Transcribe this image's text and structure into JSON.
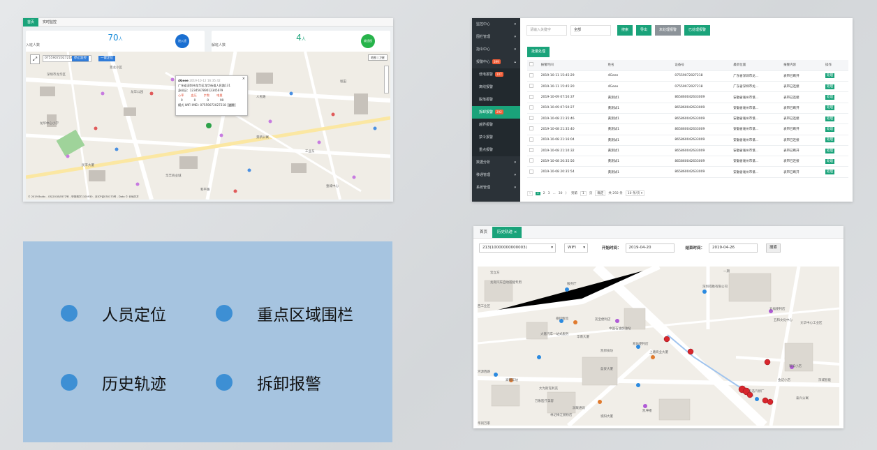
{
  "dashboard": {
    "tabs": [
      "首页",
      "实时监控"
    ],
    "stat_in": {
      "num": "70",
      "unit": "人",
      "label": "入班人数",
      "circle": "进入班"
    },
    "stat_out": {
      "num": "4",
      "unit": "人",
      "label": "解班人数",
      "circle": "收班权"
    },
    "device_input": "07559072027218",
    "map_btn1": "停止监控",
    "map_btn2": "一键定位",
    "popup": {
      "name": "4Geee",
      "time": "2019-10-12 16:35:42",
      "addr": "广东省深圳市龙华区龙华街道人民路131",
      "imei": "身份证：1234567890123456?9",
      "row1": [
        "心率",
        "血压",
        "步数",
        "电量"
      ],
      "row2": [
        "0",
        "0",
        "0",
        "99"
      ],
      "wifi_line": "模式 WIFI  IMEI: 07559072027218",
      "btn": "追踪"
    },
    "map_labels": [
      "深圳市龙华区",
      "龙华公园",
      "人民路",
      "工业东",
      "民丰大厦",
      "华丰商业城",
      "景新公寓",
      "坂田",
      "龙华中心小学",
      "壹城中心",
      "景龙小区",
      "和平路"
    ],
    "watermark": "© 2019 Baidu - GS(2018)5572号 - 甲测资字1100930 - 京ICP证030173号 - Data © 长地万方"
  },
  "alarm": {
    "menu": [
      {
        "label": "监控中心",
        "caret": "▾"
      },
      {
        "label": "围栏管理",
        "caret": "▾"
      },
      {
        "label": "指令中心",
        "caret": "▾"
      },
      {
        "label": "报警中心",
        "badge": "399",
        "caret": "▴"
      },
      {
        "label": "低电报警",
        "badge": "107",
        "sub": true
      },
      {
        "label": "离线报警",
        "sub": true
      },
      {
        "label": "脱落报警",
        "sub": true
      },
      {
        "label": "拆卸报警",
        "badge": "292",
        "sub": true,
        "on": true
      },
      {
        "label": "越界报警",
        "sub": true
      },
      {
        "label": "禁令报警",
        "sub": true
      },
      {
        "label": "重点报警",
        "sub": true
      },
      {
        "label": "数据分析",
        "caret": "▾"
      },
      {
        "label": "移通管理",
        "caret": "▾"
      },
      {
        "label": "系统管理",
        "caret": "▾"
      }
    ],
    "search_placeholder": "请输入关键字",
    "filter_value": "全部",
    "buttons": [
      "搜索",
      "导出",
      "未处理报警",
      "已处理报警"
    ],
    "batch": "批量处理",
    "columns": [
      "",
      "报警时间",
      "姓名",
      "设备号",
      "最新位置",
      "报警内容",
      "操作"
    ],
    "rows": [
      [
        "2019-10-11 15:45:29",
        "4Geee",
        "07559072027218",
        "广东省深圳市龙...",
        "表带已断开",
        "处理"
      ],
      [
        "2019-10-11 15:45:20",
        "4Geee",
        "07559072027218",
        "广东省深圳市龙...",
        "表带已连接",
        "处理"
      ],
      [
        "2019-10-09 07:50:37",
        "黄测试1",
        "865860042633009",
        "安徽省毫州市谯...",
        "表带已连接",
        "处理"
      ],
      [
        "2019-10-09 07:50:27",
        "黄测试1",
        "865860042633009",
        "安徽省毫州市谯...",
        "表带已断开",
        "处理"
      ],
      [
        "2019-10-08 21:35:46",
        "黄测试1",
        "865860042633009",
        "安徽省毫州市谯...",
        "表带已连接",
        "处理"
      ],
      [
        "2019-10-08 21:35:40",
        "黄测试1",
        "865860042633009",
        "安徽省毫州市谯...",
        "表带已断开",
        "处理"
      ],
      [
        "2019-10-08 21:16:04",
        "黄测试1",
        "865860042633009",
        "安徽省毫州市谯...",
        "表带已连接",
        "处理"
      ],
      [
        "2019-10-08 21:10:32",
        "黄测试1",
        "865860042633009",
        "安徽省毫州市谯...",
        "表带已断开",
        "处理"
      ],
      [
        "2019-10-08 20:35:56",
        "黄测试1",
        "865860042633009",
        "安徽省毫州市谯...",
        "表带已连接",
        "处理"
      ],
      [
        "2019-10-08 20:35:54",
        "黄测试1",
        "865860042633009",
        "安徽省毫州市谯...",
        "表带已断开",
        "处理"
      ]
    ],
    "pager": {
      "pages": [
        "1",
        "2",
        "3",
        "...",
        "30"
      ],
      "next": "〉",
      "goto_label": "到第",
      "goto_value": "1",
      "page_unit": "页",
      "confirm": "确定",
      "total": "共 292 条",
      "size": "10 条/页 ▾"
    }
  },
  "features": [
    "人员定位",
    "重点区域围栏",
    "历史轨迹",
    "拆卸报警"
  ],
  "history": {
    "tabs": [
      "首页",
      "历史轨迹  ×"
    ],
    "device": "213(10000000000003)",
    "mode": "WIFI",
    "start_label": "开始时间：",
    "start": "2019-04-20",
    "end_label": "结束时间：",
    "end": "2019-04-26",
    "search": "搜索",
    "map_labels": [
      "宝立方",
      "龙岗汽车自动适能专用",
      "服务厅",
      "西工业区",
      "德邦物流",
      "友宝便利店",
      "大嘉汽车一站式服务",
      "华南大厦",
      "中国石油加油站",
      "易站便利店",
      "上塘商业大厦",
      "凯邦食坊",
      "盈安大厦",
      "高锦车坊",
      "大为斯克利克",
      "万象医疗美容",
      "林记梅江肠粉店",
      "润联通讯",
      "谯阳大厦",
      "凯坤楼",
      "华润万家",
      "河源西路",
      "深圳得胜有限公司",
      "五福便利店",
      "五和文化中心",
      "文华中心工业区",
      "和美小店",
      "东浩汽修厂",
      "金记小店",
      "泰兴公寓",
      "一期",
      "深城智能"
    ]
  },
  "colors": {
    "accent": "#1aa37a",
    "sidebar": "#2b3238",
    "badge": "#f25e38",
    "feature_bg": "#a6c4e0",
    "feature_dot": "#3d8fd4"
  }
}
